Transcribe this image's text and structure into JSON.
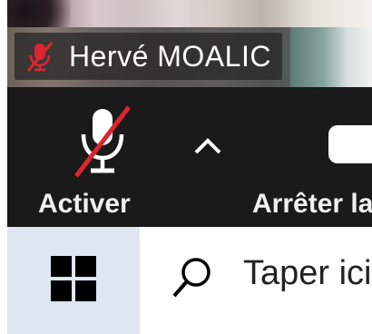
{
  "video_tile": {
    "participant_name": "Hervé MOALIC",
    "muted_icon": "microphone-muted-icon"
  },
  "toolbar": {
    "unmute_label": "Activer",
    "unmute_icon": "microphone-muted-icon",
    "audio_options_icon": "chevron-up-icon",
    "stop_video_label": "Arrêter la vidéo",
    "stop_video_icon": "video-camera-icon",
    "muted_slash_color": "#e0242f"
  },
  "taskbar": {
    "start_icon": "windows-logo-icon",
    "search_icon": "search-icon",
    "search_placeholder": "Taper ici pour rechercher"
  }
}
